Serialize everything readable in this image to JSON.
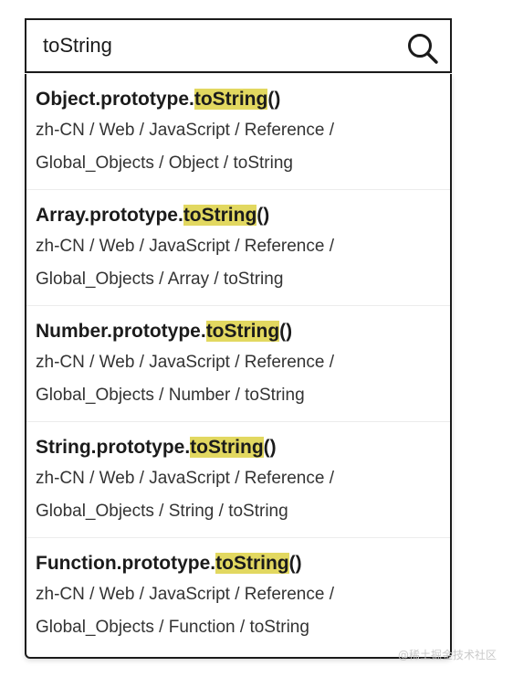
{
  "search": {
    "value": "toString"
  },
  "results": [
    {
      "title_before": "Object.prototype.",
      "title_match": "toString",
      "title_after": "()",
      "path_line1": "zh-CN / Web / JavaScript / Reference /",
      "path_line2": "Global_Objects / Object / toString"
    },
    {
      "title_before": "Array.prototype.",
      "title_match": "toString",
      "title_after": "()",
      "path_line1": "zh-CN / Web / JavaScript / Reference /",
      "path_line2": "Global_Objects / Array / toString"
    },
    {
      "title_before": "Number.prototype.",
      "title_match": "toString",
      "title_after": "()",
      "path_line1": "zh-CN / Web / JavaScript / Reference /",
      "path_line2": "Global_Objects / Number / toString"
    },
    {
      "title_before": "String.prototype.",
      "title_match": "toString",
      "title_after": "()",
      "path_line1": "zh-CN / Web / JavaScript / Reference /",
      "path_line2": "Global_Objects / String / toString"
    },
    {
      "title_before": "Function.prototype.",
      "title_match": "toString",
      "title_after": "()",
      "path_line1": "zh-CN / Web / JavaScript / Reference /",
      "path_line2": "Global_Objects / Function / toString"
    }
  ],
  "colors": {
    "highlight": "#e2d860",
    "border": "#1b1b1b"
  },
  "icons": {
    "search": "search-icon"
  },
  "watermark": "@稀土掘金技术社区"
}
